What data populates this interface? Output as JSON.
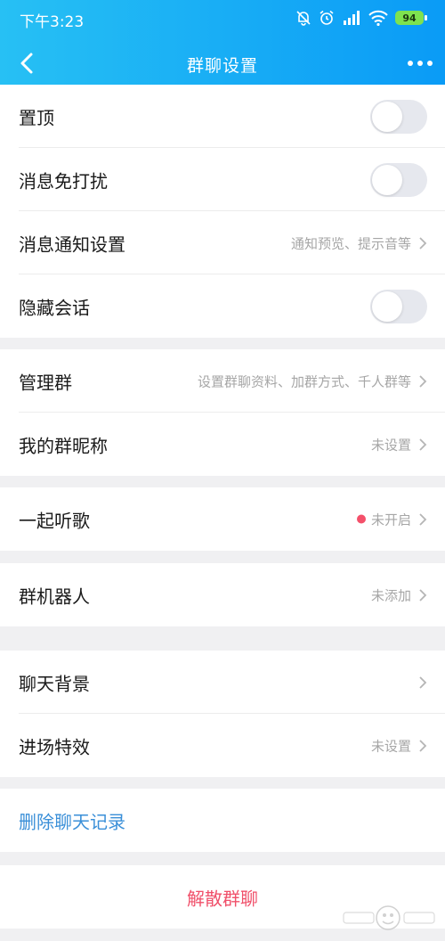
{
  "status_bar": {
    "time": "下午3:23",
    "battery": "94"
  },
  "navbar": {
    "title": "群聊设置"
  },
  "group1": {
    "pin": {
      "label": "置顶",
      "on": false
    },
    "dnd": {
      "label": "消息免打扰",
      "on": false
    },
    "notify": {
      "label": "消息通知设置",
      "value": "通知预览、提示音等"
    },
    "hide": {
      "label": "隐藏会话",
      "on": false
    }
  },
  "group2": {
    "manage": {
      "label": "管理群",
      "value": "设置群聊资料、加群方式、千人群等"
    },
    "nickname": {
      "label": "我的群昵称",
      "value": "未设置"
    }
  },
  "group3": {
    "listen": {
      "label": "一起听歌",
      "value": "未开启"
    }
  },
  "group4": {
    "robot": {
      "label": "群机器人",
      "value": "未添加"
    }
  },
  "group5": {
    "background": {
      "label": "聊天背景"
    },
    "effect": {
      "label": "进场特效",
      "value": "未设置"
    }
  },
  "group6": {
    "delete": {
      "label": "删除聊天记录"
    }
  },
  "group7": {
    "dismiss": {
      "label": "解散群聊"
    }
  },
  "colors": {
    "accent": "#0a9bf6",
    "link": "#3a8fd8",
    "danger": "#f0506a",
    "dot": "#f4506a"
  },
  "icons": [
    "back-icon",
    "more-icon",
    "chevron-right-icon",
    "bell-off-icon",
    "alarm-icon",
    "signal-icon",
    "wifi-icon",
    "battery-icon"
  ]
}
